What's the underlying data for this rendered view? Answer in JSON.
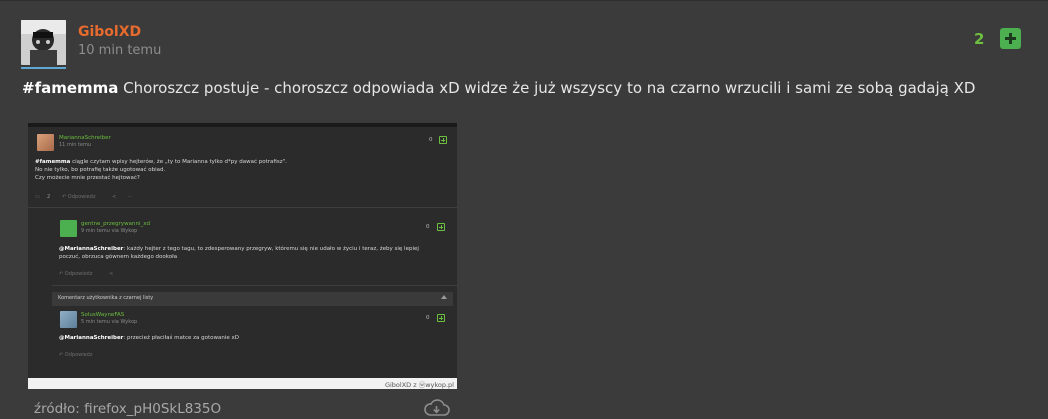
{
  "post": {
    "author": "GibolXD",
    "time": "10 min temu",
    "votes": "2",
    "tag": "#famemma",
    "text": " Choroszcz postuje - choroszcz odpowiada xD widze że już wszyscy to na czarno wrzucili i sami ze sobą gadają XD",
    "source": "źródło: firefox_pH0SkL835O",
    "icons": {
      "upvote": "plus-icon",
      "download": "cloud-download-icon"
    },
    "colors": {
      "author": "#e86b2e",
      "votes": "#6cbf3f",
      "accent": "#4caf50"
    }
  },
  "embed": {
    "main": {
      "author": "MariannaSchreiber",
      "time": "11 min temu",
      "vote": "0",
      "tag": "#famemma",
      "line1": " ciągle czytam wpisy hejterów, że „ty to Marianna tylko d*py dawać potrafisz\".",
      "line2": "No nie tylko, bo potrafię także ugotować obiad.",
      "line3": "Czy możecie mnie przestać hejtować?",
      "comments": "2",
      "reply": "Odpowiedz"
    },
    "reply1": {
      "author": "gentne_przegrywanni_xd",
      "time": "9 min temu  via Wykop",
      "vote": "0",
      "mention": "@MariannaSchreiber",
      "line1": ": każdy hejter z tego tagu, to zdesperowany przegryw, któremu się nie udało w życiu i teraz, żeby się lepiej",
      "line2": "poczuć, obrzuca gównem każdego dookoła",
      "reply": "Odpowiedz"
    },
    "collapsed": "Komentarz użytkownika z czarnej listy",
    "reply2": {
      "author": "SolusWayneFAS",
      "time": "5 min temu  via Wykop",
      "vote": "0",
      "mention": "@MariannaSchreiber",
      "line1": ": przecież płaciłaś matce za gotowanie xD",
      "reply": "Odpowiedz"
    },
    "footer": "GibolXD z ⓦwykop.pl"
  }
}
